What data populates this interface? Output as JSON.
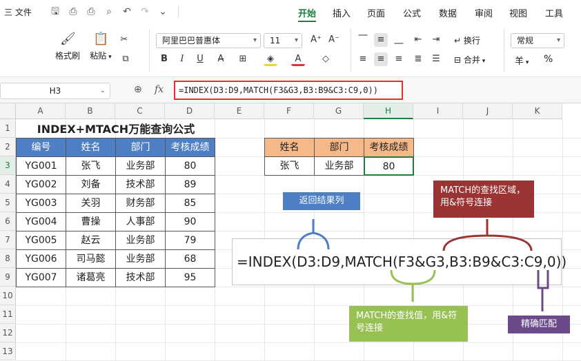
{
  "menubar": {
    "file": "三 文件",
    "tabs": [
      "开始",
      "插入",
      "页面",
      "公式",
      "数据",
      "审阅",
      "视图",
      "工具"
    ],
    "active_tab": "开始"
  },
  "ribbon": {
    "format_painter": "格式刷",
    "paste": "粘贴",
    "font_name": "阿里巴巴普惠体",
    "font_size": "11",
    "wrap": "换行",
    "merge": "合并",
    "number_format": "常规",
    "currency": "羊",
    "percent": "%"
  },
  "formula_bar": {
    "name_box": "H3",
    "fx": "fx",
    "formula": "=INDEX(D3:D9,MATCH(F3&G3,B3:B9&C3:C9,0))"
  },
  "grid": {
    "columns": [
      "A",
      "B",
      "C",
      "D",
      "E",
      "F",
      "G",
      "H",
      "I",
      "J",
      "K"
    ],
    "rows": [
      "1",
      "2",
      "3",
      "4",
      "5",
      "6",
      "7",
      "8",
      "9",
      "10",
      "11",
      "12",
      "13"
    ],
    "selected_column": "H",
    "selected_row": "3"
  },
  "sheet": {
    "title": "INDEX+MTACH万能查询公式",
    "table1": {
      "headers": [
        "编号",
        "姓名",
        "部门",
        "考核成绩"
      ],
      "rows": [
        [
          "YG001",
          "张飞",
          "业务部",
          "80"
        ],
        [
          "YG002",
          "刘备",
          "技术部",
          "89"
        ],
        [
          "YG003",
          "关羽",
          "财务部",
          "85"
        ],
        [
          "YG004",
          "曹操",
          "人事部",
          "90"
        ],
        [
          "YG005",
          "赵云",
          "业务部",
          "79"
        ],
        [
          "YG006",
          "司马懿",
          "业务部",
          "68"
        ],
        [
          "YG007",
          "诸葛亮",
          "技术部",
          "95"
        ]
      ]
    },
    "table2": {
      "headers": [
        "姓名",
        "部门",
        "考核成绩"
      ],
      "row": [
        "张飞",
        "业务部",
        "80"
      ]
    },
    "big_formula": "=INDEX(D3:D9,MATCH(F3&G3,B3:B9&C3:C9,0))",
    "notes": {
      "return_col": "返回结果列",
      "match_area": "MATCH的查找区域，用&符号连接",
      "match_value": "MATCH的查找值，用&符号连接",
      "exact": "精确匹配"
    }
  },
  "colors": {
    "accent": "#1a7f3c",
    "header_blue": "#4e7fc4",
    "header_orange": "#f5b888",
    "note_blue": "#4e7fc4",
    "note_red": "#9b3333",
    "note_green": "#98c154",
    "note_purple": "#6b4a8a",
    "highlight": "#e0312b"
  }
}
